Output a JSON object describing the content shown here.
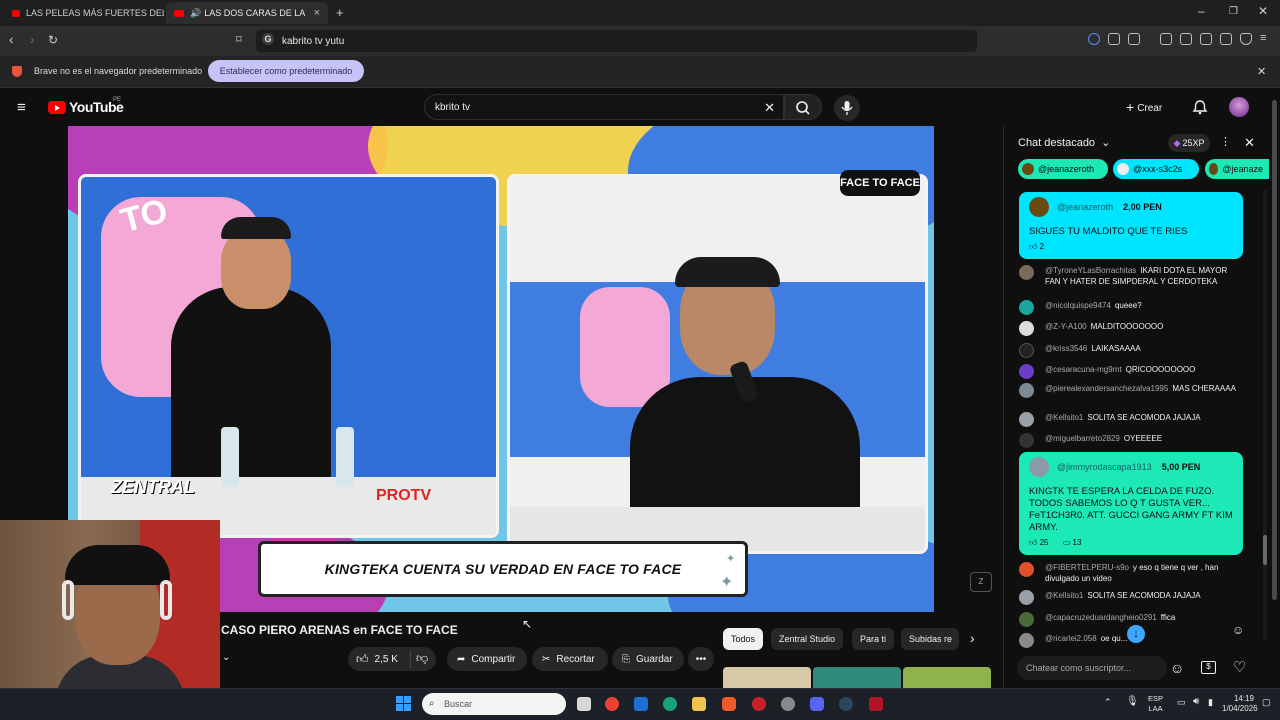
{
  "browser": {
    "tabs": [
      {
        "label": "LAS PELEAS MÁS FUERTES DEL DEBAT",
        "active": false
      },
      {
        "label": "LAS DOS CARAS DE LA MONE",
        "active": true
      }
    ],
    "address": "kabrito tv yutu",
    "infobar_text": "Brave no es el navegador predeterminado",
    "set_default_label": "Establecer como predeterminado"
  },
  "youtube": {
    "logo_text": "YouTube",
    "region": "PE",
    "search_value": "kbrito tv",
    "create_label": "Crear"
  },
  "video": {
    "caption": "KINGTEKA CUENTA SU VERDAD EN FACE TO FACE",
    "title": "CASO PIERO ARENAS en FACE TO FACE",
    "overlay_brand_1": "ZENTRAL",
    "overlay_brand_2": "PROTV",
    "overlay_logo": "FACE TO FACE"
  },
  "actions": {
    "likes": "2,5 K",
    "share": "Compartir",
    "clip": "Recortar",
    "save": "Guardar"
  },
  "filter_chips": [
    "Todos",
    "Zentral Studio",
    "Para ti",
    "Subidas re"
  ],
  "chat": {
    "title": "Chat destacado",
    "xp": "25XP",
    "ticker": [
      "@jeanazeroth",
      "@xxx-s3c2s",
      "@jeanaze"
    ],
    "superchats": [
      {
        "author": "@jeanazeroth",
        "amount": "2,00 PEN",
        "text": "SIGUES TU MALDITO QUE TE RIES",
        "reactions": "2",
        "replies": ""
      },
      {
        "author": "@jimmyrodascapa1913",
        "amount": "5,00 PEN",
        "text": "KINGTK TE ESPERA LA CELDA DE FUZO. TODOS SABEMOS LO Q T GUSTA VER... FeT1CH3R0. ATT. GUCCI GANG ARMY FT KIM ARMY.",
        "reactions": "25",
        "replies": "13"
      }
    ],
    "messages_a": [
      {
        "author": "@TyroneYLasBorrachitas",
        "text": "IKARI DOTA EL MAYOR FAN Y HATER DE SIMPDERAL Y CERDOTEKA"
      },
      {
        "author": "@nicolquispe9474",
        "text": "queee?"
      },
      {
        "author": "@Z-Y-A100",
        "text": "MALDITOOOOOOO"
      },
      {
        "author": "@kriss3546",
        "text": "LAIKASAAAA"
      },
      {
        "author": "@cesaracuna-mg9mt",
        "text": "QRICOOOOOOOO"
      },
      {
        "author": "@pierealexandersanchezalva1995",
        "text": "MAS CHERAAAA"
      },
      {
        "author": "@Kellsito1",
        "text": "SOLITA SE ACOMODA JAJAJA"
      },
      {
        "author": "@miguelbarreto2829",
        "text": "OYEEEEE"
      }
    ],
    "messages_b": [
      {
        "author": "@FIBERTELPERU-s9o",
        "text": "y eso q tiene q ver , han divulgado un video"
      },
      {
        "author": "@Kellsito1",
        "text": "SOLITA SE ACOMODA JAJAJA"
      },
      {
        "author": "@capacruzeduardangheio0291",
        "text": "ffica"
      },
      {
        "author": "@ricarlei2.058",
        "text": "oe qu..."
      }
    ],
    "input_placeholder": "Chatear como suscriptor..."
  },
  "taskbar": {
    "search_placeholder": "Buscar",
    "lang": "ESP",
    "lang2": "LAA",
    "time": "14:19",
    "date": "1/04/2026"
  }
}
